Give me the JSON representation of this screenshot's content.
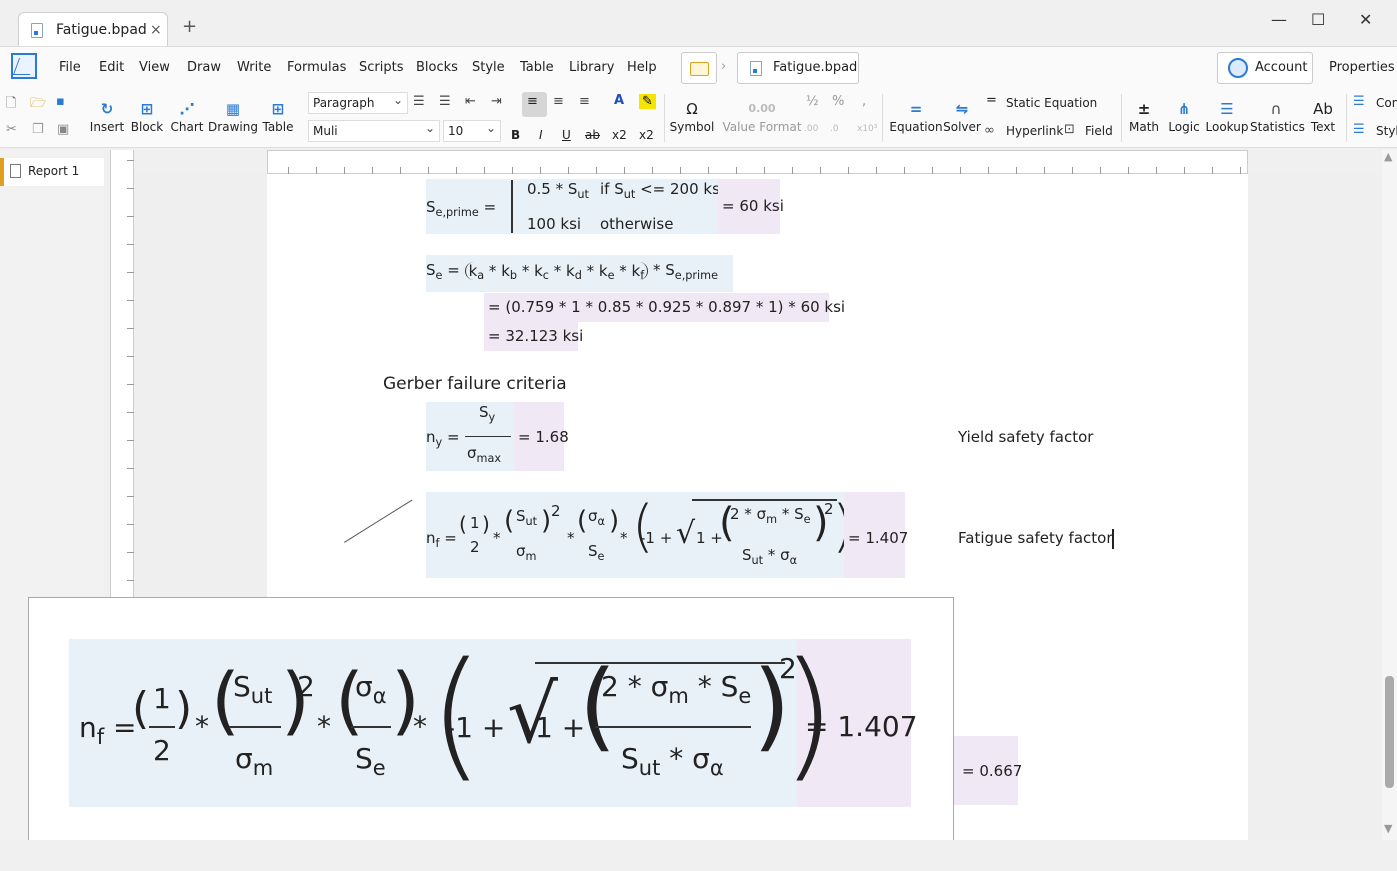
{
  "window": {
    "tab_title": "Fatigue.bpad",
    "new_tab": "+",
    "close_tab": "×",
    "minimize": "—",
    "maximize": "☐",
    "close": "✕"
  },
  "menu": {
    "items": [
      "File",
      "Edit",
      "View",
      "Draw",
      "Write",
      "Formulas",
      "Scripts",
      "Blocks",
      "Style",
      "Table",
      "Library",
      "Help"
    ],
    "breadcrumb_file": "Fatigue.bpad",
    "account": "Account",
    "properties": "Properties"
  },
  "toolbar": {
    "insert": "Insert",
    "block": "Block",
    "chart": "Chart",
    "drawing": "Drawing",
    "table": "Table",
    "style_select": "Paragraph",
    "font_select": "Muli",
    "size_select": "10",
    "bold": "B",
    "italic": "I",
    "underline": "U",
    "strike": "ab",
    "subscript": "x2",
    "superscript": "x2",
    "symbol": "Symbol",
    "value_format": "Value Format",
    "equation": "Equation",
    "solver": "Solver",
    "static_equation": "Static Equation",
    "hyperlink": "Hyperlink",
    "field": "Field",
    "math": "Math",
    "logic": "Logic",
    "lookup": "Lookup",
    "statistics": "Statistics",
    "text": "Text",
    "con": "Con",
    "sty": "Styl"
  },
  "sidebar": {
    "pages": [
      "Report 1"
    ]
  },
  "document": {
    "se_prime": {
      "lhs": "S",
      "lhs_sub": "e,prime",
      "case1_val": "0.5 * S",
      "case1_sub": "ut",
      "case1_cond": "if S",
      "case1_cond_sub": "ut",
      "case1_cond_rest": "<= 200 ksi",
      "case2_val": "100 ksi",
      "case2_cond": "otherwise",
      "result": "= 60 ksi"
    },
    "se": {
      "formula": "S",
      "line2": "= (0.759 * 1 * 0.85 * 0.925 * 0.897 * 1) * 60 ksi",
      "line3": "= 32.123 ksi"
    },
    "heading": "Gerber failure criteria",
    "ny": {
      "result": "= 1.68",
      "note": "Yield safety factor"
    },
    "nf": {
      "result": "= 1.407",
      "note": "Fatigue safety factor"
    },
    "partial_result": "= 0.667"
  },
  "zoom": {
    "result": "= 1.407"
  }
}
